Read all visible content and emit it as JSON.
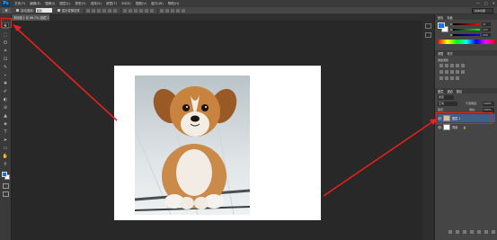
{
  "app": {
    "logo": "Ps"
  },
  "menu": [
    "文件(F)",
    "编辑(E)",
    "图像(I)",
    "图层(L)",
    "类型(Y)",
    "选择(S)",
    "滤镜(T)",
    "3D(D)",
    "视图(V)",
    "窗口(W)",
    "帮助(H)"
  ],
  "window_controls": [
    "—",
    "□",
    "✕"
  ],
  "options": {
    "tool_glyph": "✥",
    "auto_select_label": "自动选择:",
    "auto_select_value": "图层",
    "transform_label": "显示变换控件"
  },
  "workspace": "基本功能",
  "document_tab": "未标题-1 @ 66.7% (图层 1, RGB/8)",
  "tools": [
    "✥",
    "⬚",
    "ʘ",
    "⌗",
    "⊡",
    "✎",
    "⌁",
    "✚",
    "✐",
    "◐",
    "⊘",
    "▲",
    "◈",
    "T",
    "➤",
    "▭",
    "✋",
    "⚲"
  ],
  "colors": {
    "foreground": "#1e6ee6",
    "background": "#ffffff",
    "annotation": "#e8211a",
    "canvas": "#ffffff",
    "workspace_bg": "#282828"
  },
  "color_panel": {
    "tabs": [
      "颜色",
      "色板"
    ],
    "channels": [
      {
        "label": "R",
        "value": "31"
      },
      {
        "label": "G",
        "value": "123"
      },
      {
        "label": "B",
        "value": "230"
      }
    ]
  },
  "adjust_panel": {
    "tabs": [
      "调整",
      "样式"
    ],
    "title": "添加调整"
  },
  "layers_panel": {
    "tabs": [
      "图层",
      "通道",
      "路径"
    ],
    "kind_label": "类型",
    "blend_mode": "正常",
    "opacity_label": "不透明度:",
    "opacity_value": "100%",
    "lock_label": "锁定:",
    "fill_label": "填充:",
    "fill_value": "100%",
    "layers": [
      {
        "name": "图层 1",
        "selected": true,
        "eye": "👁"
      },
      {
        "name": "背景",
        "selected": false,
        "eye": "👁"
      }
    ]
  }
}
